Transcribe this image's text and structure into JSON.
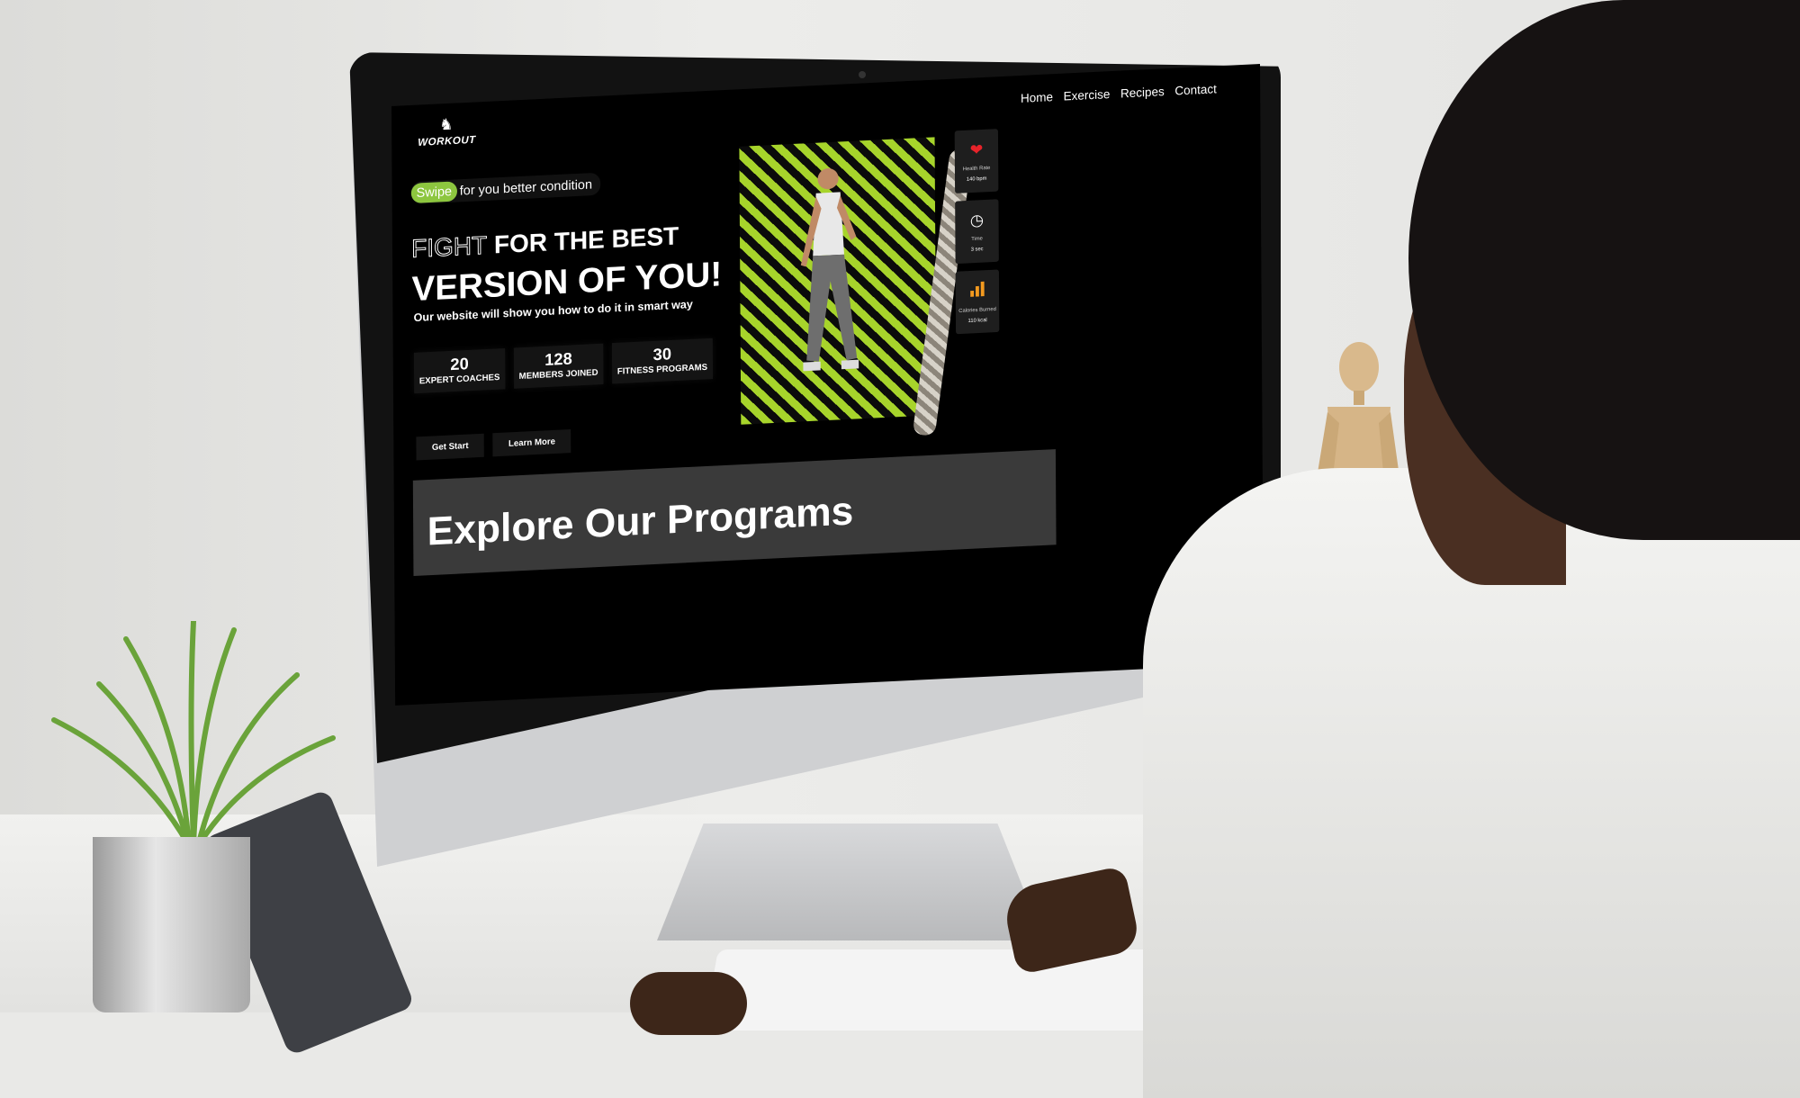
{
  "site": {
    "logo_text": "WORKOUT",
    "nav": [
      "Home",
      "Exercise",
      "Recipes",
      "Contact"
    ],
    "badge_highlight": "Swipe",
    "badge_rest": "for you better condition",
    "headline_outline": "FIGHT",
    "headline_rest": " FOR THE BEST",
    "headline_line2": "VERSION OF YOU!",
    "tagline": "Our website will show you how to do it in smart way",
    "stats": [
      {
        "value": "20",
        "label": "EXPERT COACHES"
      },
      {
        "value": "128",
        "label": "MEMBERS JOINED"
      },
      {
        "value": "30",
        "label": "FITNESS PROGRAMS"
      }
    ],
    "buttons": {
      "primary": "Get Start",
      "secondary": "Learn More"
    },
    "metric_cards": [
      {
        "icon": "heart-icon",
        "label": "Health Rate",
        "value": "140 bpm"
      },
      {
        "icon": "clock-icon",
        "label": "Time",
        "value": "3 sec"
      },
      {
        "icon": "bar-chart-icon",
        "label": "Calories Burned",
        "value": "110 kcal"
      }
    ],
    "section_title": "Explore Our Programs"
  },
  "colors": {
    "accent": "#8dc63f",
    "stripe": "#a7d42b",
    "background": "#000000",
    "heart": "#e8232a",
    "chart": "#f39a1f"
  }
}
